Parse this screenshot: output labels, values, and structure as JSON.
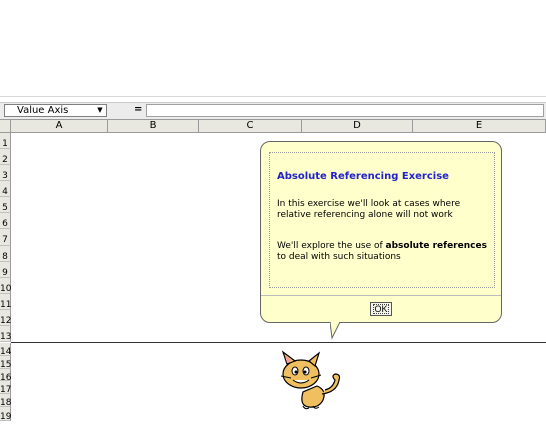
{
  "namebox": {
    "value": "Value Axis"
  },
  "formula": {
    "equals": "="
  },
  "columns": [
    "A",
    "B",
    "C",
    "D",
    "E"
  ],
  "rows": [
    "1",
    "2",
    "3",
    "4",
    "5",
    "6",
    "7",
    "8",
    "9",
    "10",
    "11",
    "12",
    "13",
    "14",
    "15",
    "16",
    "17",
    "18",
    "19"
  ],
  "bubble": {
    "title": "Absolute Referencing Exercise",
    "para1": "In this exercise we'll look at cases where relative referencing alone will not work",
    "para2_prefix": "We'll explore the use of ",
    "para2_bold": "absolute references",
    "para2_suffix": " to deal with such situations",
    "ok_label": "OK"
  },
  "colors": {
    "title": "#2222cc",
    "bubble_bg": "#ffffcc",
    "header_bg": "#e8e8e0"
  }
}
